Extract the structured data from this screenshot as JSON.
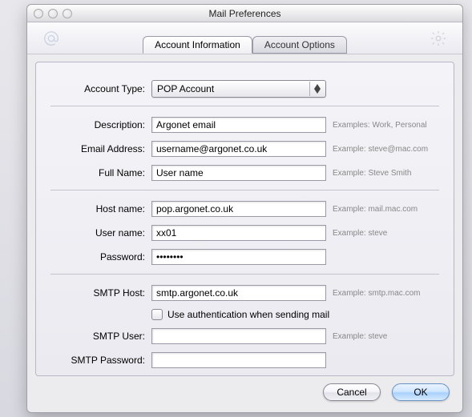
{
  "window": {
    "title": "Mail Preferences"
  },
  "tabs": {
    "active": "Account Information",
    "inactive": "Account Options"
  },
  "fields": {
    "account_type": {
      "label": "Account Type:",
      "value": "POP Account"
    },
    "description": {
      "label": "Description:",
      "value": "Argonet email",
      "hint": "Examples: Work, Personal"
    },
    "email": {
      "label": "Email Address:",
      "value": "username@argonet.co.uk",
      "hint": "Example: steve@mac.com"
    },
    "fullname": {
      "label": "Full Name:",
      "value": "User name",
      "hint": "Example: Steve Smith"
    },
    "host": {
      "label": "Host name:",
      "value": "pop.argonet.co.uk",
      "hint": "Example: mail.mac.com"
    },
    "user": {
      "label": "User name:",
      "value": "xx01",
      "hint": "Example: steve"
    },
    "password": {
      "label": "Password:",
      "value": "••••••••"
    },
    "smtp_host": {
      "label": "SMTP Host:",
      "value": "smtp.argonet.co.uk",
      "hint": "Example: smtp.mac.com"
    },
    "smtp_auth": {
      "label": "Use authentication when sending mail",
      "checked": false
    },
    "smtp_user": {
      "label": "SMTP User:",
      "value": "",
      "hint": "Example: steve"
    },
    "smtp_pass": {
      "label": "SMTP Password:",
      "value": ""
    }
  },
  "buttons": {
    "cancel": "Cancel",
    "ok": "OK"
  }
}
